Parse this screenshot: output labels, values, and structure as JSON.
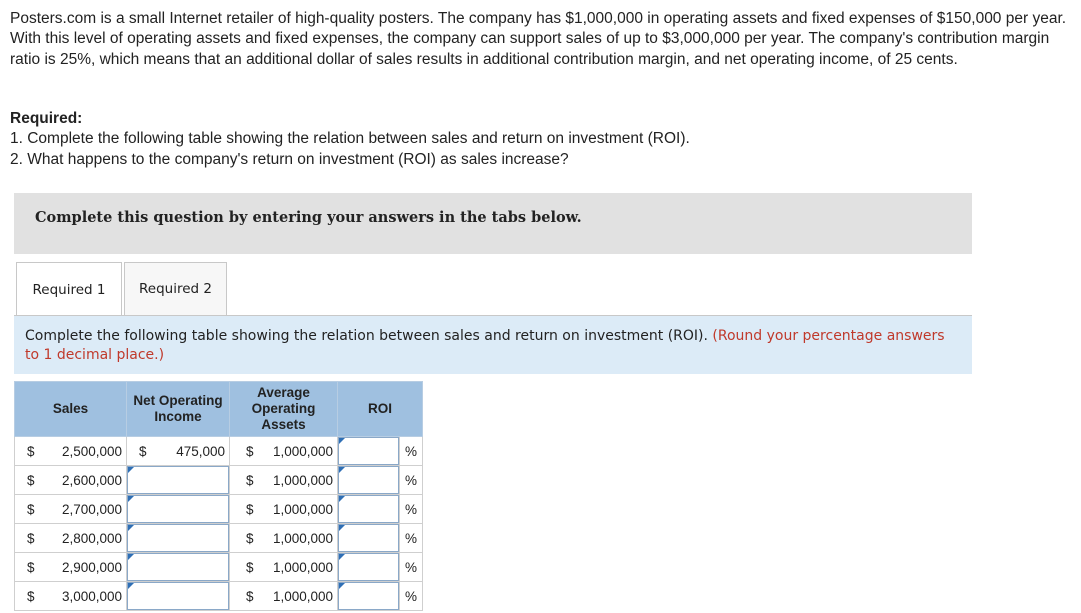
{
  "intro": "Posters.com is a small Internet retailer of high-quality posters. The company has $1,000,000 in operating assets and fixed expenses of $150,000 per year. With this level of operating assets and fixed expenses, the company can support sales of up to $3,000,000 per year. The company's contribution margin ratio is 25%, which means that an additional dollar of sales results in additional contribution margin, and net operating income, of 25 cents.",
  "required": {
    "title": "Required:",
    "items": [
      "1. Complete the following table showing the relation between sales and return on investment (ROI).",
      "2. What happens to the company's return on investment (ROI) as sales increase?"
    ]
  },
  "banner": "Complete this question by entering your answers in the tabs below.",
  "tabs": [
    {
      "label": "Required 1",
      "active": true
    },
    {
      "label": "Required 2",
      "active": false
    }
  ],
  "instructions": {
    "text": "Complete the following table showing the relation between sales and return on investment (ROI). ",
    "hint": "(Round your percentage answers to 1 decimal place.)"
  },
  "table": {
    "headers": {
      "sales": "Sales",
      "noi_line1": "Net Operating",
      "noi_line2": "Income",
      "assets_line1": "Average",
      "assets_line2": "Operating",
      "assets_line3": "Assets",
      "roi": "ROI"
    },
    "currency": "$",
    "percent": "%",
    "rows": [
      {
        "sales": "2,500,000",
        "noi": "475,000",
        "assets": "1,000,000"
      },
      {
        "sales": "2,600,000",
        "noi": "",
        "assets": "1,000,000"
      },
      {
        "sales": "2,700,000",
        "noi": "",
        "assets": "1,000,000"
      },
      {
        "sales": "2,800,000",
        "noi": "",
        "assets": "1,000,000"
      },
      {
        "sales": "2,900,000",
        "noi": "",
        "assets": "1,000,000"
      },
      {
        "sales": "3,000,000",
        "noi": "",
        "assets": "1,000,000"
      }
    ]
  }
}
